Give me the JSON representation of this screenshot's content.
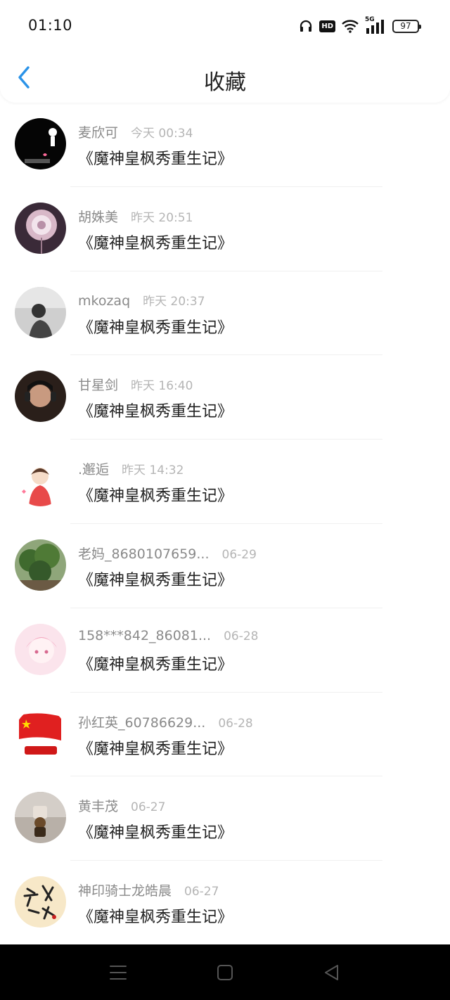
{
  "status_bar": {
    "time": "01:10",
    "battery": "97",
    "network": "5G",
    "hd": "HD"
  },
  "header": {
    "title": "收藏",
    "back_icon": "chevron-left-icon"
  },
  "colors": {
    "accent": "#2b93e8",
    "name": "#8a8a8a",
    "time": "#b5b5b5",
    "title": "#222222",
    "nav_bg": "#000000"
  },
  "items": [
    {
      "name": "麦欣可",
      "time": "今天 00:34",
      "title": "《魔神皇枫秀重生记》"
    },
    {
      "name": "胡姝美",
      "time": "昨天 20:51",
      "title": "《魔神皇枫秀重生记》"
    },
    {
      "name": "mkozaq",
      "time": "昨天 20:37",
      "title": "《魔神皇枫秀重生记》"
    },
    {
      "name": "甘星剑",
      "time": "昨天 16:40",
      "title": "《魔神皇枫秀重生记》"
    },
    {
      "name": ".邂逅",
      "time": "昨天 14:32",
      "title": "《魔神皇枫秀重生记》"
    },
    {
      "name": "老妈_8680107659...",
      "time": "06-29",
      "title": "《魔神皇枫秀重生记》"
    },
    {
      "name": "158***842_86081...",
      "time": "06-28",
      "title": "《魔神皇枫秀重生记》"
    },
    {
      "name": "孙红英_60786629...",
      "time": "06-28",
      "title": "《魔神皇枫秀重生记》"
    },
    {
      "name": "黄丰茂",
      "time": "06-27",
      "title": "《魔神皇枫秀重生记》"
    },
    {
      "name": "神印骑士龙皓晨",
      "time": "06-27",
      "title": "《魔神皇枫秀重生记》"
    }
  ],
  "system_nav": {
    "menu_icon": "menu-icon",
    "home_icon": "home-icon",
    "back_icon": "back-triangle-icon"
  }
}
